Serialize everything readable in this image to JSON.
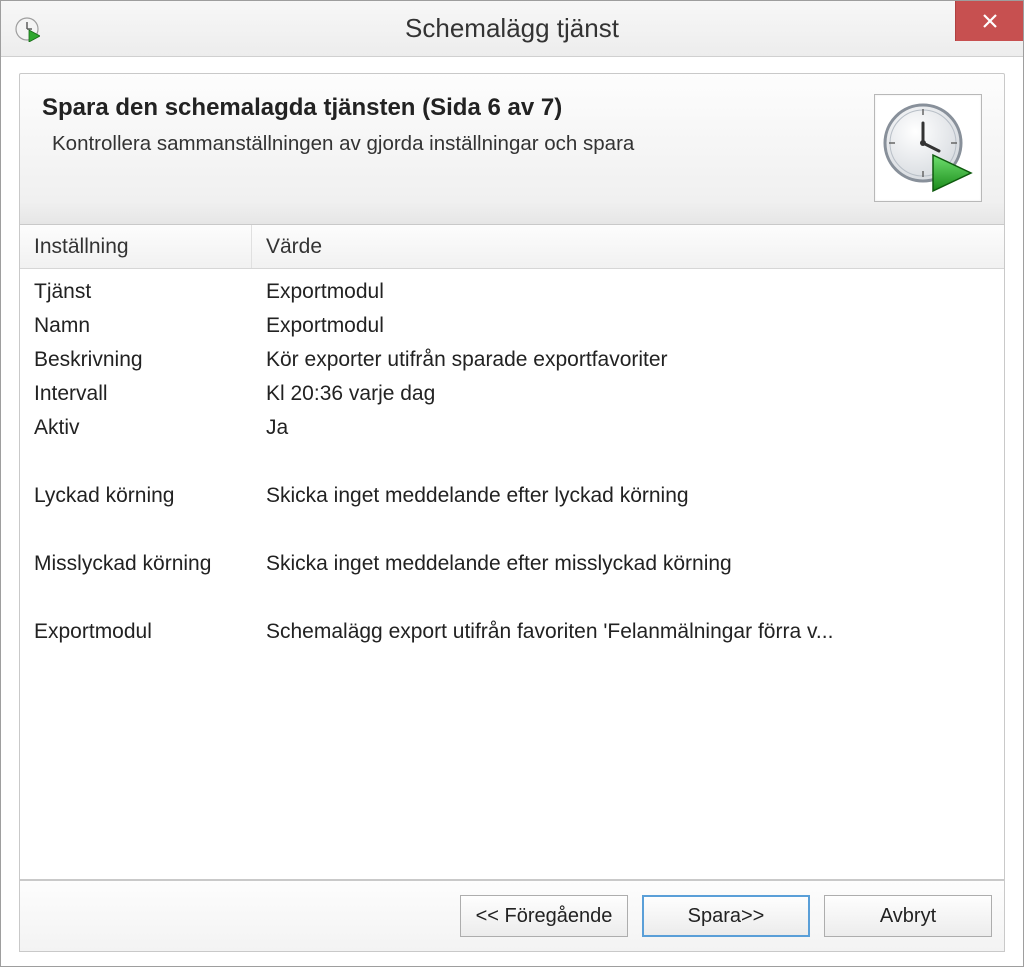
{
  "window": {
    "title": "Schemalägg tjänst"
  },
  "header": {
    "title": "Spara den schemalagda tjänsten  (Sida 6 av 7)",
    "subtitle": "Kontrollera sammanställningen av gjorda inställningar och spara"
  },
  "table": {
    "columns": {
      "setting": "Inställning",
      "value": "Värde"
    },
    "rows": [
      {
        "setting": "Tjänst",
        "value": "Exportmodul"
      },
      {
        "setting": "Namn",
        "value": "Exportmodul"
      },
      {
        "setting": "Beskrivning",
        "value": "Kör exporter utifrån sparade exportfavoriter"
      },
      {
        "setting": "Intervall",
        "value": "Kl 20:36 varje dag"
      },
      {
        "setting": "Aktiv",
        "value": "Ja"
      },
      {
        "spacer": true
      },
      {
        "setting": "Lyckad körning",
        "value": "Skicka inget meddelande efter lyckad körning"
      },
      {
        "spacer": true
      },
      {
        "setting": "Misslyckad körning",
        "value": "Skicka inget meddelande efter misslyckad körning"
      },
      {
        "spacer": true
      },
      {
        "setting": "Exportmodul",
        "value": "Schemalägg export utifrån favoriten 'Felanmälningar förra v..."
      }
    ]
  },
  "buttons": {
    "previous": "<< Föregående",
    "save": "Spara>>",
    "cancel": "Avbryt"
  }
}
